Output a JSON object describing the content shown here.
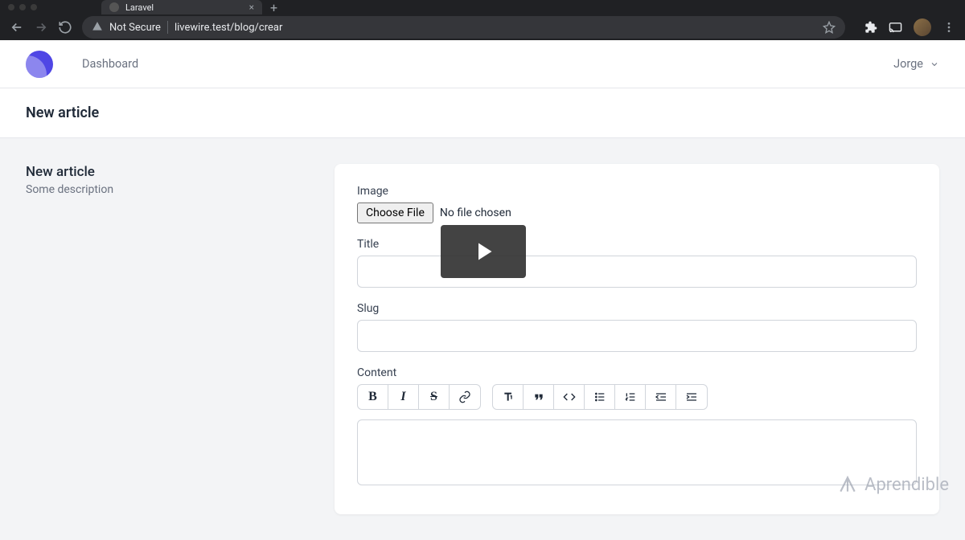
{
  "browser": {
    "tab_title": "Laravel",
    "not_secure": "Not Secure",
    "url": "livewire.test/blog/crear"
  },
  "nav": {
    "dashboard": "Dashboard",
    "user_name": "Jorge"
  },
  "page": {
    "title": "New article"
  },
  "side": {
    "title": "New article",
    "description": "Some description"
  },
  "form": {
    "image_label": "Image",
    "choose_file": "Choose File",
    "no_file": "No file chosen",
    "title_label": "Title",
    "title_value": "",
    "slug_label": "Slug",
    "slug_value": "",
    "content_label": "Content"
  },
  "watermark": {
    "brand": "Aprendible"
  }
}
